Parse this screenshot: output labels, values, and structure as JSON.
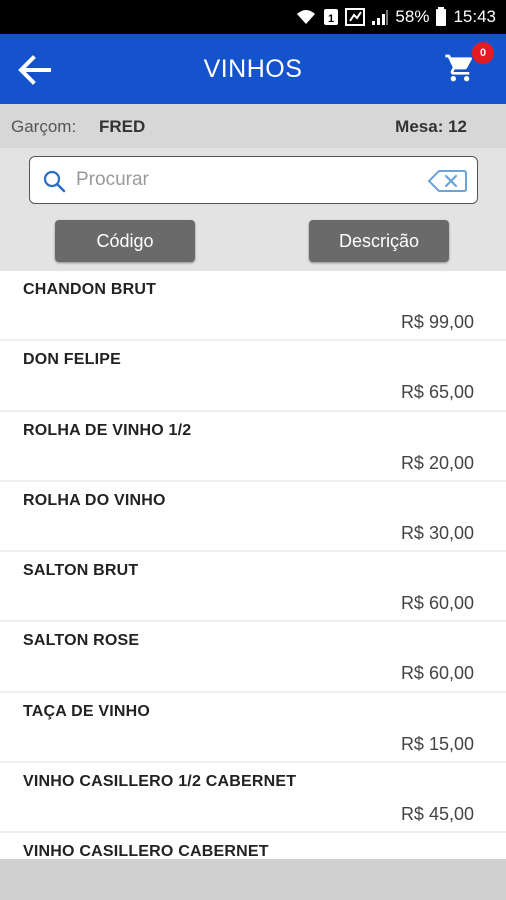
{
  "status_bar": {
    "battery": "58%",
    "time": "15:43",
    "sim_badge": "1"
  },
  "header": {
    "title": "VINHOS",
    "cart_count": "0"
  },
  "info": {
    "waiter_label": "Garçom:",
    "waiter_name": "FRED",
    "table": "Mesa: 12"
  },
  "search": {
    "placeholder": "Procurar",
    "value": ""
  },
  "filters": {
    "code_label": "Código",
    "description_label": "Descrição"
  },
  "items": [
    {
      "name": "CHANDON BRUT",
      "price": "R$ 99,00"
    },
    {
      "name": "DON FELIPE",
      "price": "R$ 65,00"
    },
    {
      "name": "ROLHA DE VINHO 1/2",
      "price": "R$ 20,00"
    },
    {
      "name": "ROLHA DO VINHO",
      "price": "R$ 30,00"
    },
    {
      "name": "SALTON BRUT",
      "price": "R$ 60,00"
    },
    {
      "name": "SALTON ROSE",
      "price": "R$ 60,00"
    },
    {
      "name": "TAÇA DE VINHO",
      "price": "R$ 15,00"
    },
    {
      "name": "VINHO CASILLERO 1/2 CABERNET",
      "price": "R$ 45,00"
    },
    {
      "name": "VINHO CASILLERO CABERNET",
      "price": ""
    }
  ],
  "colors": {
    "app_bar": "#1453cc",
    "badge": "#e51b23",
    "button": "#6a6a6a"
  }
}
